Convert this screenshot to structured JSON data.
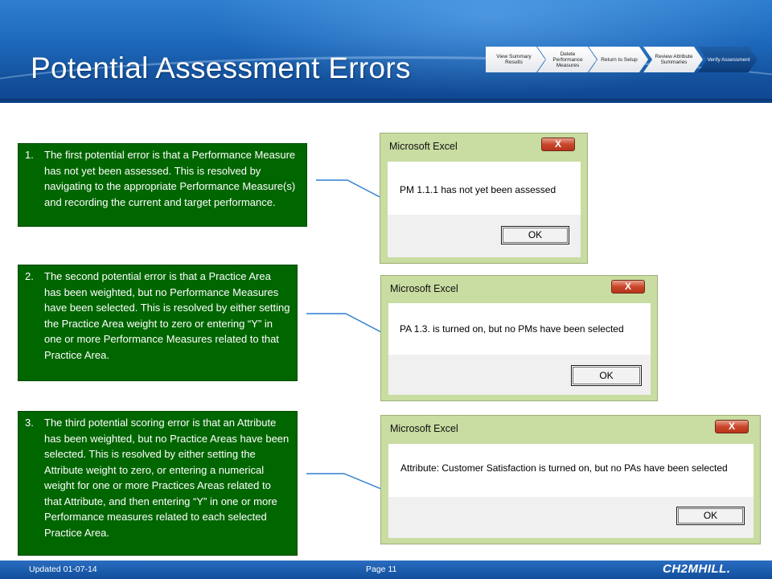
{
  "slide": {
    "title": "Potential Assessment Errors"
  },
  "nav": {
    "items": [
      {
        "label": "View Summary Results",
        "active": false
      },
      {
        "label": "Delete Performance Measures",
        "active": false
      },
      {
        "label": "Return to Setup",
        "active": false
      },
      {
        "label": "Review Attribute Summaries",
        "active": false
      },
      {
        "label": "Verify Assessment",
        "active": true
      }
    ]
  },
  "notes": [
    {
      "number": "1.",
      "text": "The first potential error is that a Performance Measure has not yet been assessed.  This is resolved by navigating to the appropriate Performance Measure(s) and recording the current and target performance."
    },
    {
      "number": "2.",
      "text": "The second potential error is that a Practice Area has been weighted, but no Performance Measures have been selected. This is resolved by either setting the Practice Area weight to zero or entering “Y” in one or more Performance Measures related to that Practice Area."
    },
    {
      "number": "3.",
      "text": "The third potential scoring error is that an Attribute has been weighted, but no Practice Areas have been selected. This is resolved by either setting the Attribute weight to zero, or entering a numerical weight for one or more Practices Areas related to that Attribute, and then entering “Y” in one or more Performance measures related to each selected Practice Area."
    }
  ],
  "dialogs": [
    {
      "title": "Microsoft Excel",
      "close": "X",
      "message": "PM 1.1.1 has not yet been assessed",
      "button": "OK"
    },
    {
      "title": "Microsoft Excel",
      "close": "X",
      "message": "PA 1.3. is turned on, but no PMs have been selected",
      "button": "OK"
    },
    {
      "title": "Microsoft Excel",
      "close": "X",
      "message": "Attribute: Customer Satisfaction is turned on, but no PAs have been selected",
      "button": "OK"
    }
  ],
  "footer": {
    "updated": "Updated 01-07-14",
    "page": "Page 11",
    "logo": "CH2MHILL."
  },
  "colors": {
    "header_blue": "#1c66b8",
    "note_green": "#006600",
    "dialog_frame": "#c9dca1",
    "arrow_blue": "#2f7fd0"
  }
}
